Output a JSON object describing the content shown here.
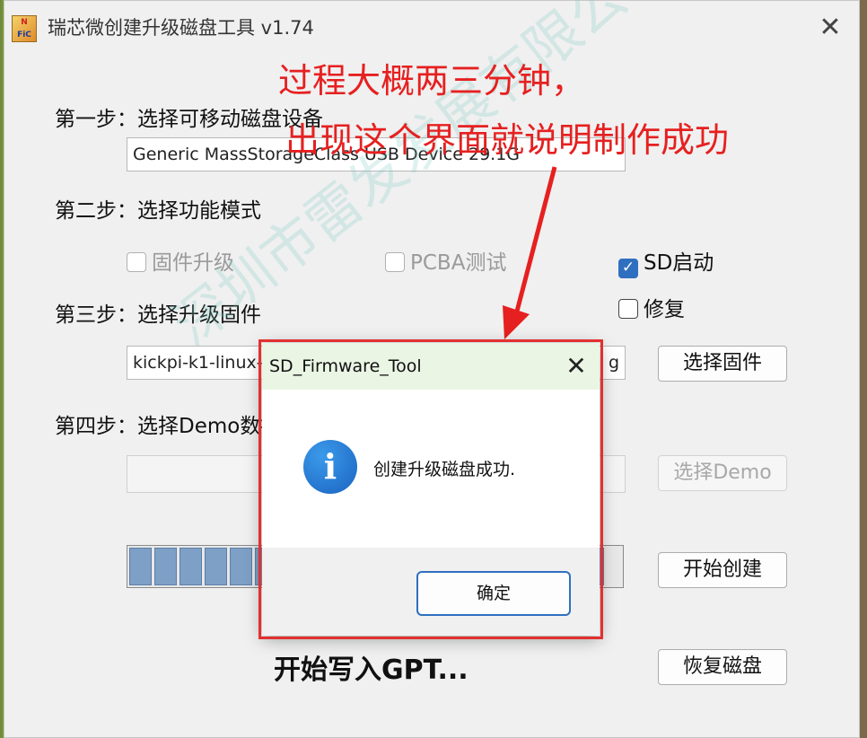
{
  "window": {
    "title": "瑞芯微创建升级磁盘工具 v1.74",
    "icon_text_top": "N",
    "icon_text_bottom": "FiC"
  },
  "step1": {
    "label": "第一步：选择可移动磁盘设备",
    "device_value": "Generic MassStorageClass USB Device    29.1G"
  },
  "step2": {
    "label": "第二步：选择功能模式",
    "options": [
      {
        "label": "固件升级",
        "checked": false,
        "enabled": false
      },
      {
        "label": "PCBA测试",
        "checked": false,
        "enabled": false
      },
      {
        "label": "SD启动",
        "checked": true,
        "enabled": true
      },
      {
        "label": "修复",
        "checked": false,
        "enabled": true
      }
    ]
  },
  "step3": {
    "label": "第三步：选择升级固件",
    "firmware_value": "kickpi-k1-linux-",
    "firmware_value_tail": "g",
    "button": "选择固件"
  },
  "step4": {
    "label": "第四步：选择Demo数据",
    "demo_value": "",
    "button": "选择Demo"
  },
  "buttons": {
    "start": "开始创建",
    "restore": "恢复磁盘"
  },
  "progress": {
    "segments": 19,
    "fraction": 1.0
  },
  "status_text": "开始写入GPT...",
  "watermark": "深圳市雷发发展有限公司",
  "annotation": {
    "line1": "过程大概两三分钟，",
    "line2": "出现这个界面就说明制作成功",
    "color": "#e62020"
  },
  "dialog": {
    "title": "SD_Firmware_Tool",
    "message": "创建升级磁盘成功.",
    "ok": "确定",
    "icon": "info-icon"
  }
}
